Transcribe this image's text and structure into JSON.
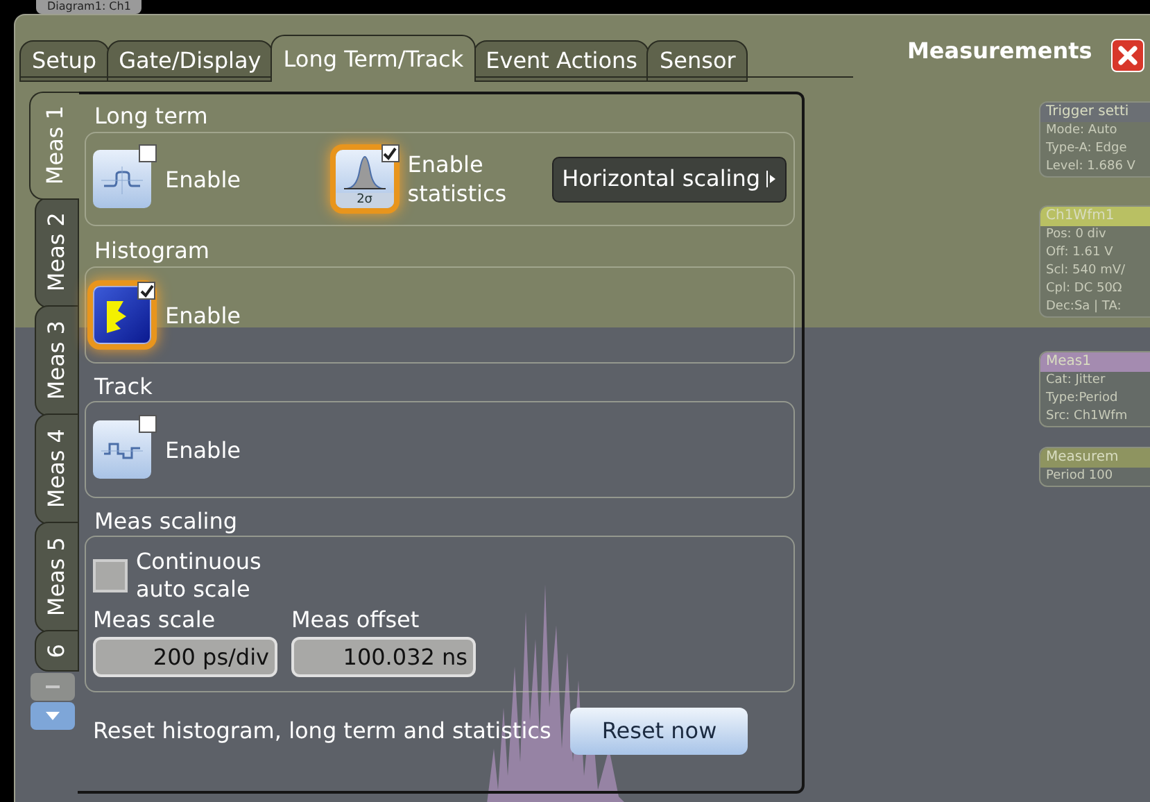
{
  "background": {
    "diagram_label": "Diagram1: Ch1",
    "info_panels": [
      {
        "title": "Trigger setti",
        "color": "#6b6f74",
        "lines": [
          "Mode: Auto",
          "Type-A: Edge",
          "Level: 1.686 V"
        ]
      },
      {
        "title": "Ch1Wfm1",
        "color": "#b9c063",
        "lines": [
          "Pos: 0 div",
          "Off: 1.61 V",
          "Scl: 540 mV/",
          "Cpl: DC 50Ω",
          "Dec:Sa | TA:"
        ]
      },
      {
        "title": "Meas1",
        "color": "#a48bb0",
        "lines": [
          "Cat: Jitter",
          "Type:Period",
          "Src: Ch1Wfm"
        ]
      },
      {
        "title": "Measurem",
        "color": "#8e9460",
        "lines": [
          "Period  100"
        ]
      }
    ]
  },
  "window": {
    "title": "Measurements"
  },
  "tabs": [
    {
      "label": "Setup",
      "selected": false
    },
    {
      "label": "Gate/Display",
      "selected": false
    },
    {
      "label": "Long Term/Track",
      "selected": true
    },
    {
      "label": "Event Actions",
      "selected": false
    },
    {
      "label": "Sensor",
      "selected": false
    }
  ],
  "side_tabs": [
    {
      "label": "Meas 1",
      "selected": true
    },
    {
      "label": "Meas 2",
      "selected": false
    },
    {
      "label": "Meas 3",
      "selected": false
    },
    {
      "label": "Meas 4",
      "selected": false
    },
    {
      "label": "Meas 5",
      "selected": false
    },
    {
      "label": "6",
      "selected": false
    }
  ],
  "long_term": {
    "title": "Long term",
    "enable": {
      "label": "Enable",
      "checked": false
    },
    "statistics": {
      "label": "Enable statistics",
      "icon_text": "2σ",
      "checked": true
    },
    "button": "Horizontal scaling"
  },
  "histogram": {
    "title": "Histogram",
    "enable": {
      "label": "Enable",
      "checked": true
    }
  },
  "track": {
    "title": "Track",
    "enable": {
      "label": "Enable",
      "checked": false
    }
  },
  "meas_scaling": {
    "title": "Meas scaling",
    "auto_scale": {
      "label": "Continuous auto scale",
      "checked": false
    },
    "scale": {
      "label": "Meas scale",
      "value": "200 ps/div"
    },
    "offset": {
      "label": "Meas offset",
      "value": "100.032 ns"
    }
  },
  "reset": {
    "text": "Reset histogram, long term and statistics",
    "button": "Reset now"
  }
}
